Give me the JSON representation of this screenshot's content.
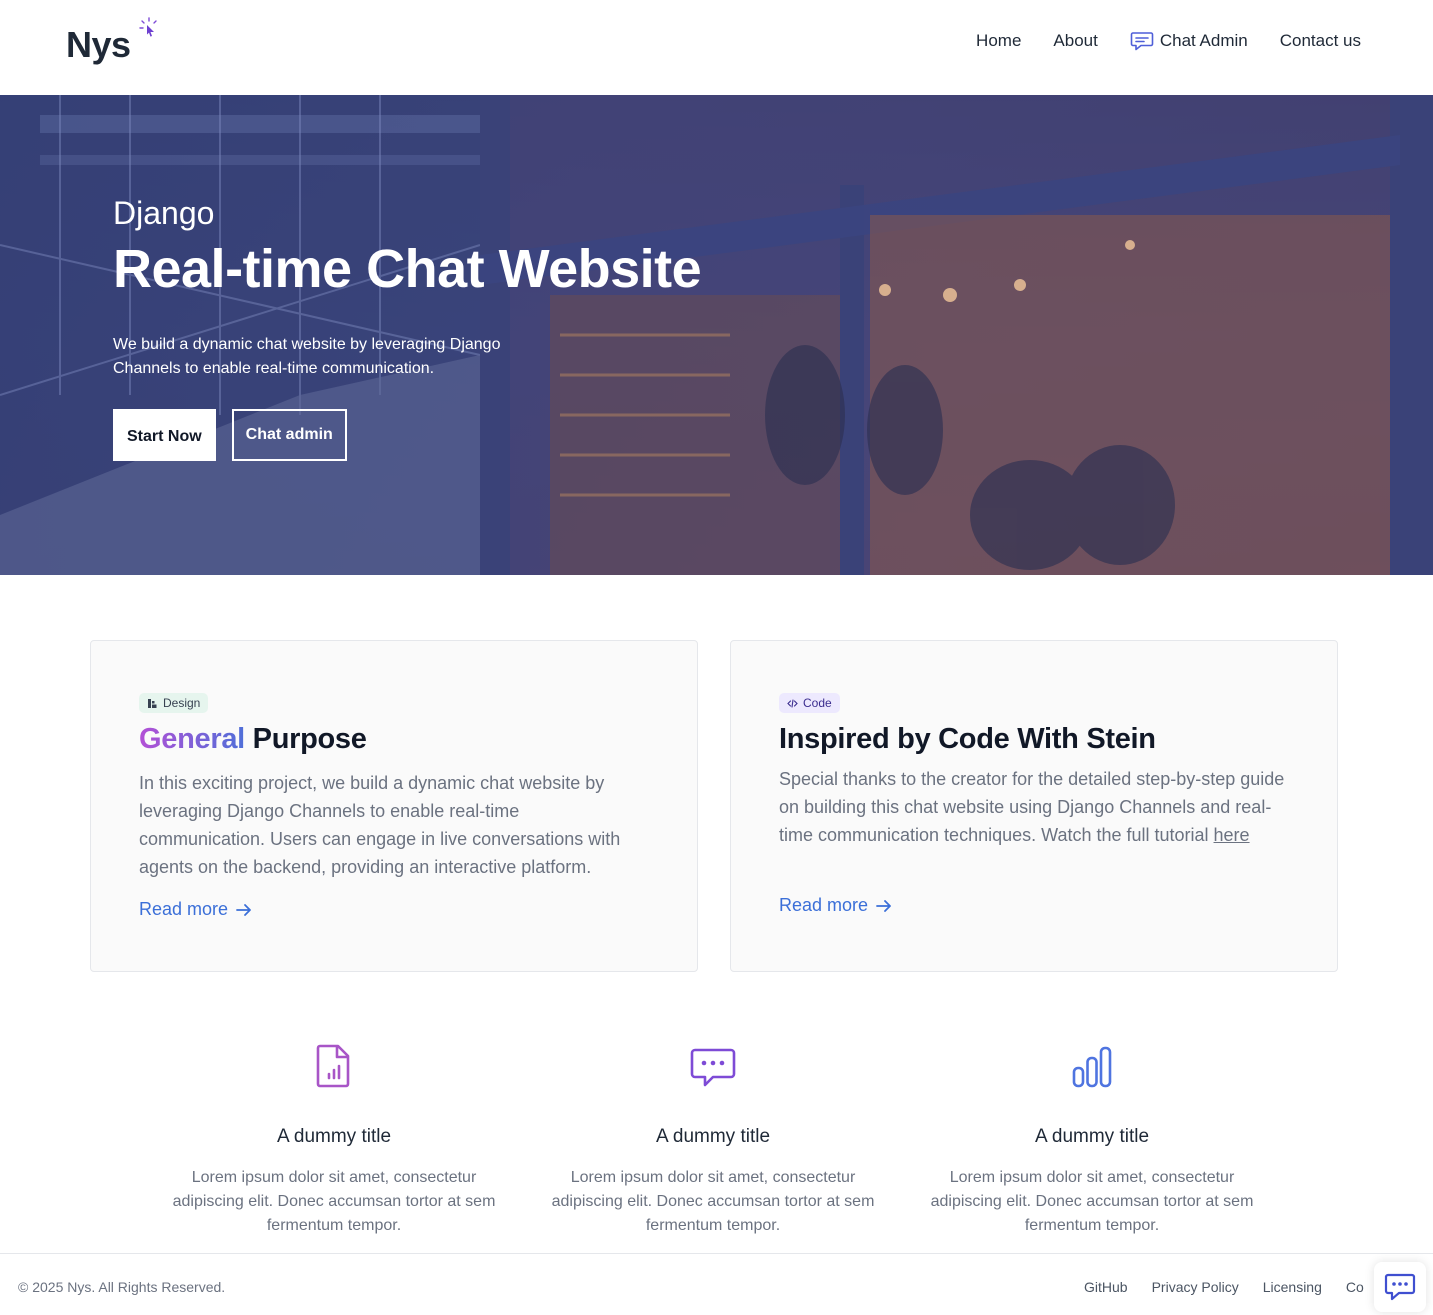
{
  "header": {
    "logo": "Nys",
    "logo_icon": "sparkle-cursor-icon",
    "nav": [
      {
        "label": "Home"
      },
      {
        "label": "About"
      },
      {
        "label": "Chat Admin",
        "icon": "chat-bubble-icon"
      },
      {
        "label": "Contact us"
      }
    ]
  },
  "hero": {
    "kicker": "Django",
    "title": "Real-time Chat Website",
    "description": "We build a dynamic chat website by leveraging Django Channels to enable real-time communication.",
    "primary_button": "Start Now",
    "secondary_button": "Chat admin"
  },
  "cards": [
    {
      "badge": "Design",
      "badge_icon": "design-icon",
      "title_highlight": "General",
      "title_rest": " Purpose",
      "text": "In this exciting project, we build a dynamic chat website by leveraging Django Channels to enable real-time communication. Users can engage in live conversations with agents on the backend, providing an interactive platform.",
      "link": "Read more"
    },
    {
      "badge": "Code",
      "badge_icon": "code-icon",
      "title": "Inspired by Code With Stein",
      "text": "Special thanks to the creator for the detailed step-by-step guide on building this chat website using Django Channels and real-time communication techniques. Watch the full tutorial ",
      "text_link": "here",
      "link": "Read more"
    }
  ],
  "features": [
    {
      "icon": "document-chart-icon",
      "title": "A dummy title",
      "text": "Lorem ipsum dolor sit amet, consectetur adipiscing elit. Donec accumsan tortor at sem fermentum tempor."
    },
    {
      "icon": "message-dots-icon",
      "title": "A dummy title",
      "text": "Lorem ipsum dolor sit amet, consectetur adipiscing elit. Donec accumsan tortor at sem fermentum tempor."
    },
    {
      "icon": "bar-chart-icon",
      "title": "A dummy title",
      "text": "Lorem ipsum dolor sit amet, consectetur adipiscing elit. Donec accumsan tortor at sem fermentum tempor."
    }
  ],
  "footer": {
    "copyright": "© 2025 Nys. All Rights Reserved.",
    "links": [
      "GitHub",
      "Privacy Policy",
      "Licensing",
      "Co"
    ]
  },
  "colors": {
    "accent": "#3b6fd8",
    "gradient_start": "#b350d6",
    "gradient_end": "#4f6fd8",
    "icon_purple": "#a855c7",
    "icon_violet": "#7e4bd6",
    "icon_blue": "#4f74e0"
  }
}
